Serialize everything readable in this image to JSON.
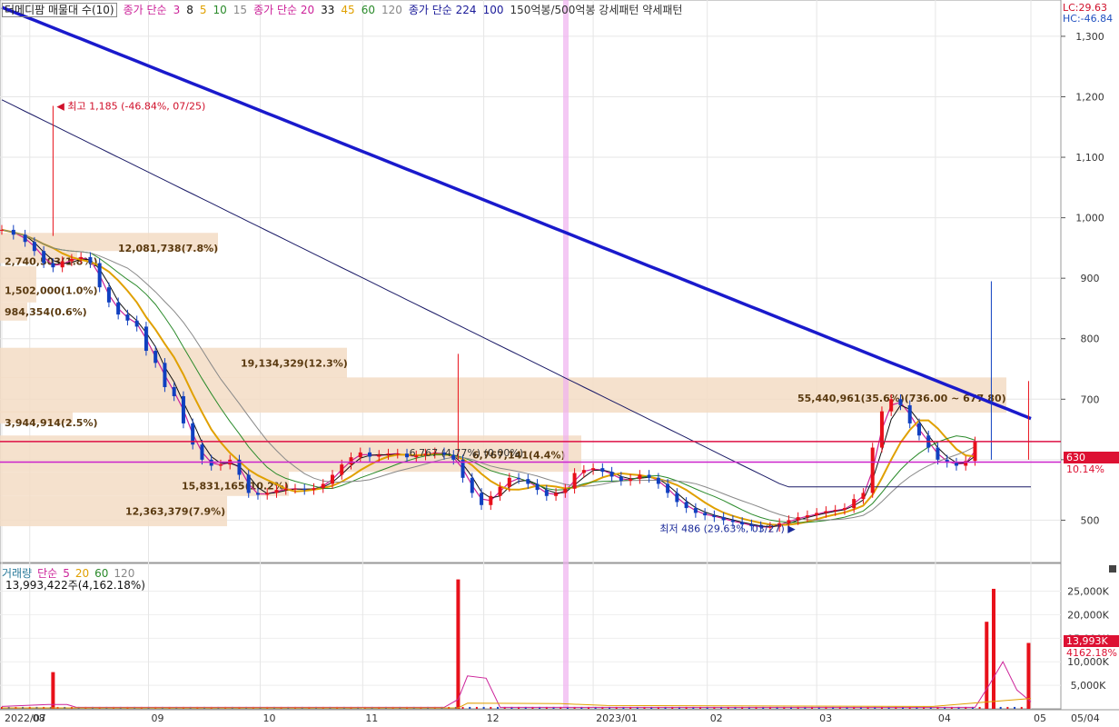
{
  "legend": {
    "items": [
      {
        "text": "더메디팜 매물대 수(10)",
        "color": "#222222"
      },
      {
        "text": "종가 단순",
        "color": "#cc2299"
      },
      {
        "text": "3",
        "color": "#cc2299"
      },
      {
        "text": "8",
        "color": "#111111"
      },
      {
        "text": "5",
        "color": "#e0a000"
      },
      {
        "text": "10",
        "color": "#2a8a2a"
      },
      {
        "text": "15",
        "color": "#888888"
      },
      {
        "text": "종가 단순 20",
        "color": "#cc2299"
      },
      {
        "text": "33",
        "color": "#111111"
      },
      {
        "text": "45",
        "color": "#e0a000"
      },
      {
        "text": "60",
        "color": "#2a8a2a"
      },
      {
        "text": "120",
        "color": "#888888"
      },
      {
        "text": "종가 단순 224",
        "color": "#1a1a99"
      },
      {
        "text": "100",
        "color": "#1a1a99"
      },
      {
        "text": "150억봉/500억봉 강세패턴  약세패턴",
        "color": "#333333"
      }
    ],
    "lc": "LC:29.63",
    "hc": "HC:-46.84"
  },
  "volume_legend": {
    "title": "거래량",
    "ma_label": "단순",
    "ma": [
      "5",
      "20",
      "60",
      "120"
    ],
    "ma_colors": [
      "#cc2299",
      "#e0a000",
      "#2a8a2a",
      "#888888"
    ],
    "info": "13,993,422주(4,162.18%)"
  },
  "price_badges": {
    "current_price": "630",
    "current_change": "10.14%",
    "volume_value": "13,993K",
    "volume_change": "4162.18%"
  },
  "annotations": {
    "high": "최고 1,185 (-46.84%, 07/25)",
    "low": "최저 486 (29.63%, 03/27)",
    "mid_label": "6 767 (4 77%)   (0.00%)"
  },
  "chart_data": {
    "type": "candlestick",
    "price_axis": {
      "ticks": [
        500,
        600,
        700,
        800,
        900,
        1000,
        1100,
        1200,
        1300
      ],
      "tick_labels": [
        "500",
        "600",
        "700",
        "800",
        "900",
        "1,000",
        "1,100",
        "1,200",
        "1,300"
      ],
      "ylim": [
        430,
        1360
      ]
    },
    "volume_axis": {
      "ticks": [
        5000,
        10000,
        15000,
        20000,
        25000
      ],
      "tick_labels": [
        "5,000K",
        "10,000K",
        "15,000K",
        "20,000K",
        "25,000K"
      ],
      "ylim": [
        0,
        28000
      ]
    },
    "x_axis": {
      "ticks": [
        "2022/07",
        "08",
        "09",
        "10",
        "11",
        "12",
        "2023/01",
        "02",
        "03",
        "04",
        "05",
        "05/04"
      ],
      "tick_days": [
        0,
        12,
        63,
        111,
        155,
        207,
        254,
        303,
        350,
        401,
        442,
        442
      ]
    },
    "price_series_days": [
      0,
      5,
      10,
      14,
      18,
      22,
      26,
      30,
      34,
      38,
      42,
      46,
      50,
      54,
      58,
      62,
      66,
      70,
      74,
      78,
      82,
      86,
      90,
      94,
      98,
      102,
      106,
      110,
      114,
      118,
      122,
      126,
      130,
      134,
      138,
      142,
      146,
      150,
      154,
      158,
      162,
      166,
      170,
      174,
      178,
      182,
      186,
      190,
      194,
      198,
      202,
      206,
      210,
      214,
      218,
      222,
      226,
      230,
      234,
      238,
      242,
      246,
      250,
      254,
      258,
      262,
      266,
      270,
      274,
      278,
      282,
      286,
      290,
      294,
      298,
      302,
      306,
      310,
      314,
      318,
      322,
      326,
      330,
      334,
      338,
      342,
      346,
      350,
      354,
      358,
      362,
      366,
      370,
      374,
      378,
      382,
      386,
      390,
      394,
      398,
      402,
      406,
      410,
      414,
      418,
      420,
      422,
      424,
      426,
      428,
      430,
      432,
      434,
      436,
      438,
      440,
      442
    ],
    "close": [
      980,
      972,
      960,
      945,
      925,
      918,
      928,
      932,
      935,
      925,
      885,
      860,
      840,
      830,
      820,
      780,
      760,
      720,
      705,
      660,
      625,
      600,
      590,
      592,
      600,
      575,
      545,
      542,
      545,
      550,
      552,
      552,
      550,
      553,
      560,
      575,
      592,
      604,
      612,
      605,
      608,
      610,
      610,
      604,
      607,
      610,
      612,
      608,
      600,
      570,
      545,
      525,
      540,
      555,
      570,
      568,
      560,
      550,
      540,
      545,
      552,
      578,
      583,
      586,
      580,
      572,
      565,
      568,
      575,
      570,
      560,
      545,
      530,
      520,
      512,
      508,
      505,
      500,
      497,
      493,
      490,
      488,
      489,
      495,
      500,
      505,
      508,
      512,
      515,
      517,
      520,
      535,
      545,
      620,
      680,
      700,
      690,
      660,
      640,
      620,
      600,
      595,
      590,
      598,
      630
    ],
    "high_points": [
      {
        "day": 22,
        "price": 1185,
        "label": "최고"
      }
    ],
    "low_points": [
      {
        "day": 345,
        "price": 486,
        "label": "최저"
      }
    ],
    "volume": [
      {
        "day": 22,
        "value": 7800,
        "color": "red"
      },
      {
        "day": 196,
        "value": 27500,
        "color": "red"
      },
      {
        "day": 423,
        "value": 18500,
        "color": "red"
      },
      {
        "day": 426,
        "value": 25500,
        "color": "red"
      },
      {
        "day": 441,
        "value": 14000,
        "color": "red"
      }
    ],
    "horizontal_lines": [
      {
        "price": 630,
        "color": "#dd1144"
      },
      {
        "price": 596,
        "color": "#cc22cc"
      }
    ],
    "volume_profile": [
      {
        "label": "12,081,738(7.8%)"
      },
      {
        "label": "2,740,503(1.8%)"
      },
      {
        "label": "1,502,000(1.0%)"
      },
      {
        "label": "984,354(0.6%)"
      },
      {
        "label": "19,134,329(12.3%)"
      },
      {
        "label": "55,440,961(35.6%)(736.00 ~ 677.80)"
      },
      {
        "label": "3,944,914(2.5%)"
      },
      {
        "label": "6,767,141(4.4%)"
      },
      {
        "label": "15,831,165(10.2%)"
      },
      {
        "label": "12,363,379(7.9%)"
      }
    ]
  }
}
